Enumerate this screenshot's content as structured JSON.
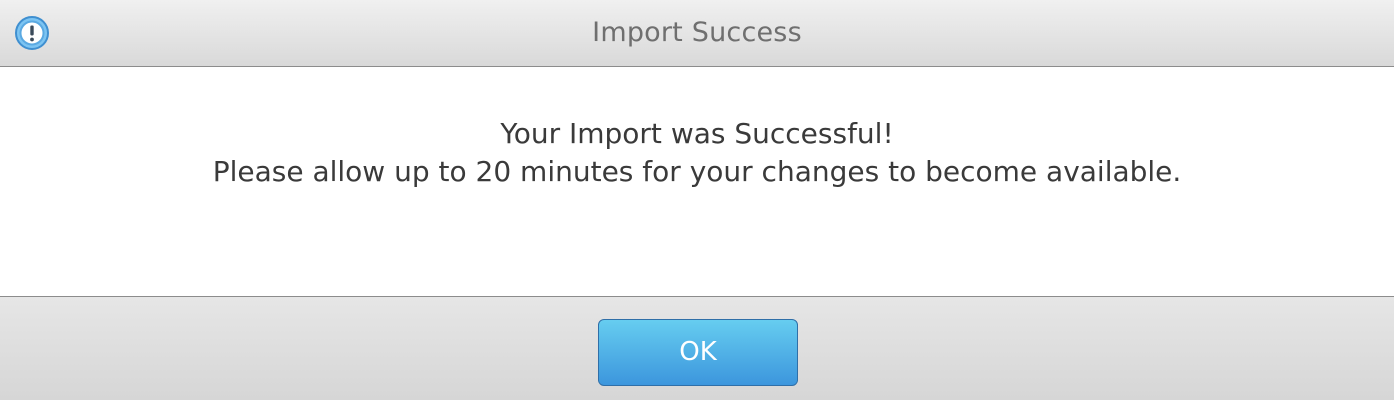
{
  "dialog": {
    "title": "Import Success",
    "icon": "info-alert-icon",
    "message_line1": "Your Import was Successful!",
    "message_line2": "Please allow up to 20 minutes for your changes to become available.",
    "ok_label": "OK"
  },
  "colors": {
    "accent": "#4aa8e6",
    "title_text": "#6f6f6f",
    "body_text": "#3a3a3a"
  }
}
